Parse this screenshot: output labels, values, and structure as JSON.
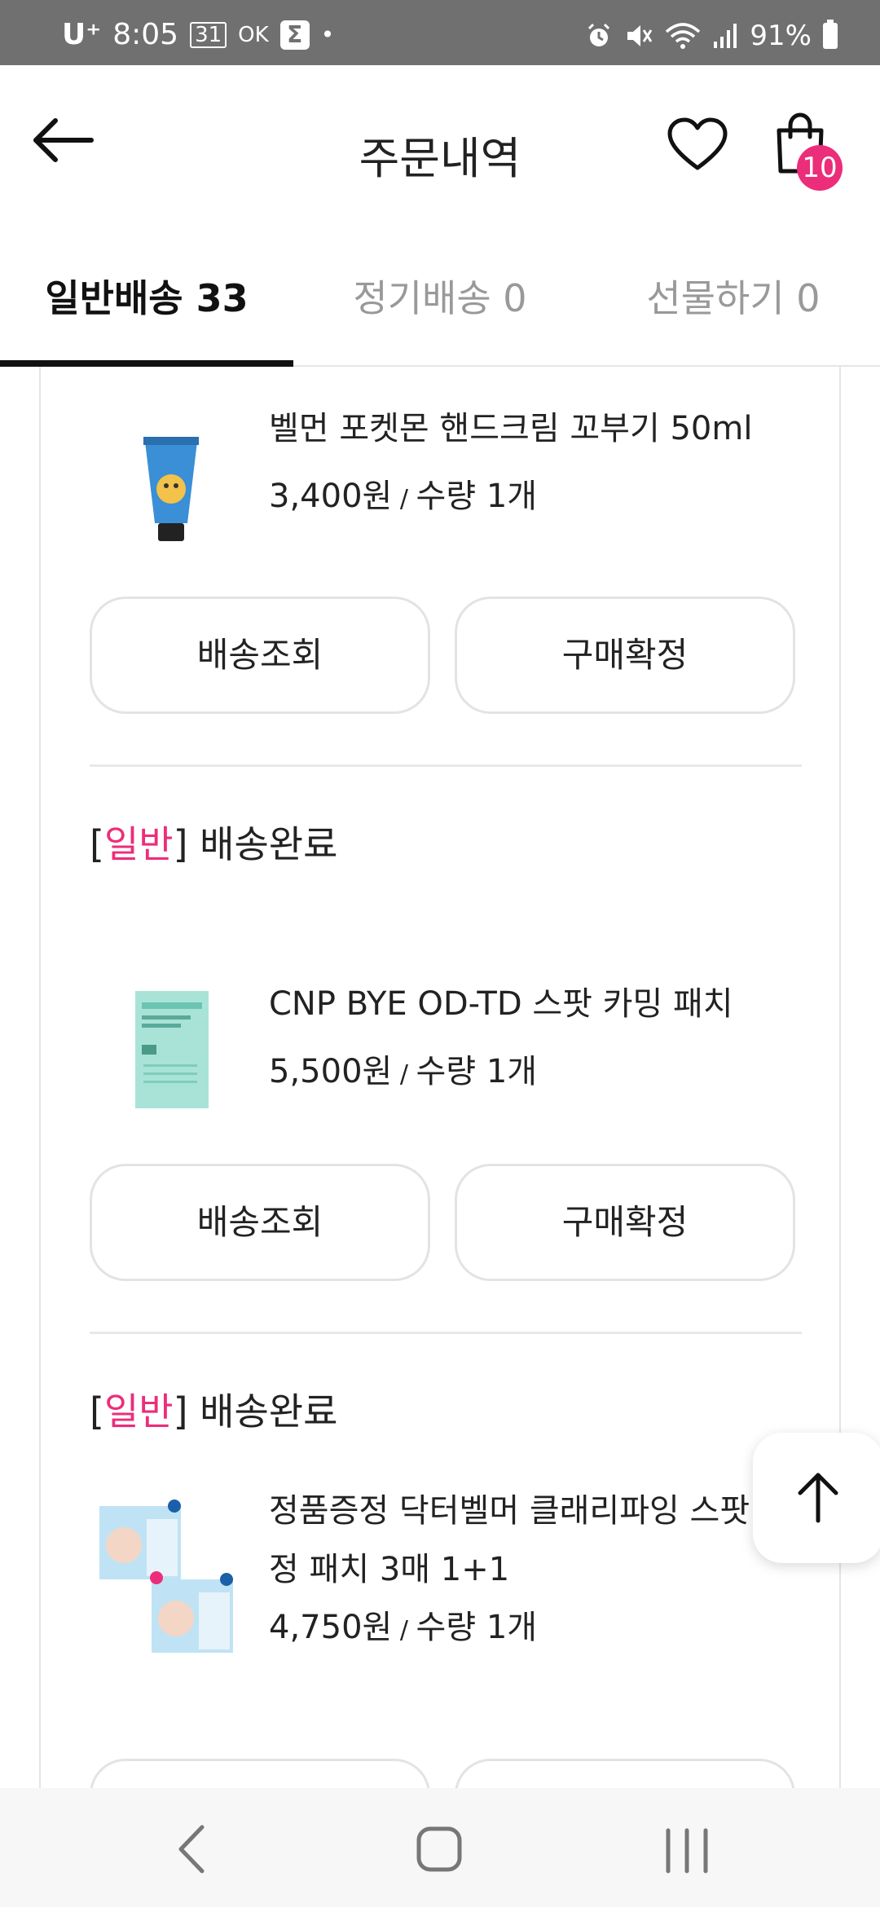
{
  "status_bar": {
    "carrier": "U⁺",
    "time": "8:05",
    "calendar_day": "31",
    "ok_icon": "OK",
    "sigma_icon": "Σ",
    "dot": "•",
    "battery": "91%"
  },
  "header": {
    "title": "주문내역",
    "cart_count": "10"
  },
  "tabs": [
    {
      "label": "일반배송 33",
      "active": true
    },
    {
      "label": "정기배송 0",
      "active": false
    },
    {
      "label": "선물하기 0",
      "active": false
    }
  ],
  "orders": [
    {
      "product_name": "벨먼 포켓몬 핸드크림 꼬부기 50ml",
      "price": "3,400원",
      "separator": " / ",
      "quantity": "수량 1개",
      "buttons": [
        "배송조회",
        "구매확정"
      ]
    },
    {
      "status_open": "[",
      "category": "일반",
      "status_close": "]",
      "status": " 배송완료",
      "product_name": "CNP BYE OD-TD 스팟 카밍 패치",
      "price": "5,500원",
      "separator": " / ",
      "quantity": "수량 1개",
      "buttons": [
        "배송조회",
        "구매확정"
      ]
    },
    {
      "status_open": "[",
      "category": "일반",
      "status_close": "]",
      "status": " 배송완료",
      "product_name": "정품증정 닥터벨머 클래리파잉 스팟 진정 패치 3매 1+1",
      "price": "4,750원",
      "separator": " / ",
      "quantity": "수량 1개"
    }
  ],
  "colors": {
    "accent_pink": "#ec2d7a",
    "status_bar": "#707070",
    "border": "#e3e3e3"
  },
  "icons": {
    "back": "arrow-left-icon",
    "wishlist": "heart-icon",
    "cart": "shopping-bag-icon",
    "scroll_top": "arrow-up-icon"
  }
}
